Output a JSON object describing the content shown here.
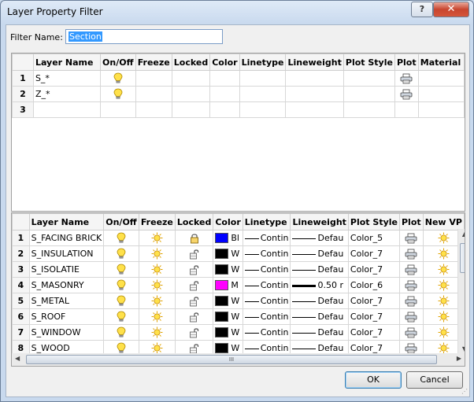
{
  "window": {
    "title": "Layer Property Filter",
    "help_label": "?",
    "close_label": "✕"
  },
  "filter": {
    "label": "Filter Name:",
    "value": "Section"
  },
  "columns_top": [
    "",
    "Layer Name",
    "On/Off",
    "Freeze",
    "Locked",
    "Color",
    "Linetype",
    "Lineweight",
    "Plot Style",
    "Plot",
    "Material"
  ],
  "top_rows": [
    {
      "num": "1",
      "name": "S_*"
    },
    {
      "num": "2",
      "name": "Z_*"
    },
    {
      "num": "3",
      "name": ""
    }
  ],
  "columns_bottom": [
    "",
    "Layer Name",
    "On/Off",
    "Freeze",
    "Locked",
    "Color",
    "Linetype",
    "Lineweight",
    "Plot Style",
    "Plot",
    "New VP"
  ],
  "layers": [
    {
      "num": "1",
      "name": "S_FACING BRICK",
      "color_hex": "#0000ff",
      "color_text": "Bl",
      "linetype": "Contin",
      "lineweight": "Defau",
      "plot_style": "Color_5",
      "locked": true
    },
    {
      "num": "2",
      "name": "S_INSULATION",
      "color_hex": "#000000",
      "color_text": "W",
      "linetype": "Contin",
      "lineweight": "Defau",
      "plot_style": "Color_7",
      "locked": false
    },
    {
      "num": "3",
      "name": "S_ISOLATIE",
      "color_hex": "#000000",
      "color_text": "W",
      "linetype": "Contin",
      "lineweight": "Defau",
      "plot_style": "Color_7",
      "locked": false
    },
    {
      "num": "4",
      "name": "S_MASONRY",
      "color_hex": "#ff00ff",
      "color_text": "M",
      "linetype": "Contin",
      "lineweight": "0.50 r",
      "plot_style": "Color_6",
      "locked": false,
      "thick": true
    },
    {
      "num": "5",
      "name": "S_METAL",
      "color_hex": "#000000",
      "color_text": "W",
      "linetype": "Contin",
      "lineweight": "Defau",
      "plot_style": "Color_7",
      "locked": false
    },
    {
      "num": "6",
      "name": "S_ROOF",
      "color_hex": "#000000",
      "color_text": "W",
      "linetype": "Contin",
      "lineweight": "Defau",
      "plot_style": "Color_7",
      "locked": false
    },
    {
      "num": "7",
      "name": "S_WINDOW",
      "color_hex": "#000000",
      "color_text": "W",
      "linetype": "Contin",
      "lineweight": "Defau",
      "plot_style": "Color_7",
      "locked": false
    },
    {
      "num": "8",
      "name": "S_WOOD",
      "color_hex": "#000000",
      "color_text": "W",
      "linetype": "Contin",
      "lineweight": "Defau",
      "plot_style": "Color_7",
      "locked": false
    }
  ],
  "scroll": {
    "up": "▲",
    "down": "▼",
    "left": "◀",
    "right": "▶",
    "grip": "III"
  },
  "buttons": {
    "ok": "OK",
    "cancel": "Cancel"
  }
}
